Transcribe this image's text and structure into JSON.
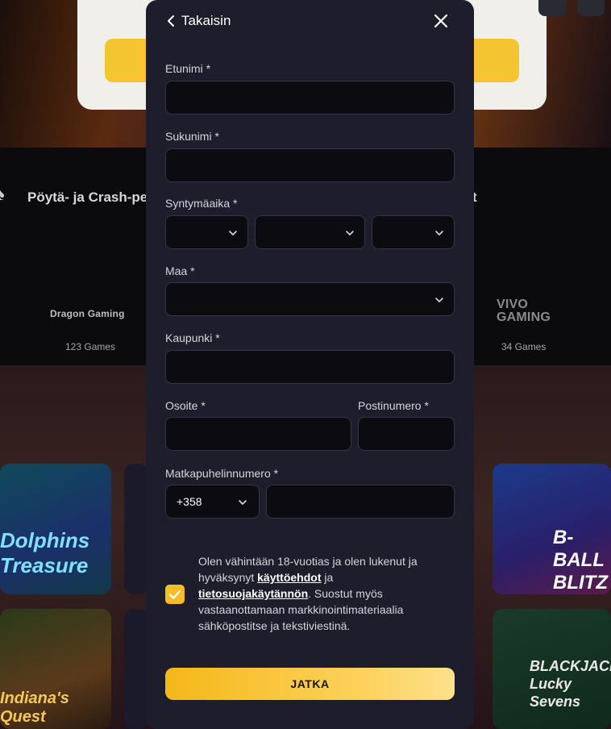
{
  "background": {
    "section_title": "Pöytä- ja Crash-pe",
    "section_title_right": "t",
    "providers": [
      {
        "name": "Dragon Gaming",
        "games": "123 Games"
      },
      {
        "name": "VIVO GAMING",
        "games": "34 Games"
      }
    ],
    "tiles": [
      "Dolphins Treasure",
      "B-BALL BLITZ",
      "Indiana's Quest",
      "BLACKJACK Lucky Sevens"
    ]
  },
  "header": {
    "back_label": "Takaisin"
  },
  "form": {
    "first_name_label": "Etunimi *",
    "last_name_label": "Sukunimi *",
    "birthdate_label": "Syntymäaika *",
    "country_label": "Maa *",
    "city_label": "Kaupunki *",
    "address_label": "Osoite *",
    "postcode_label": "Postinumero *",
    "phone_label": "Matkapuhelinnumero *",
    "phone_code": "+358",
    "values": {
      "first_name": "",
      "last_name": "",
      "day": "",
      "month": "",
      "year": "",
      "country": "",
      "city": "",
      "address": "",
      "postcode": "",
      "phone": ""
    }
  },
  "consent": {
    "checked": true,
    "text_1": "Olen vähintään 18-vuotias ja olen lukenut ja hyväksynyt ",
    "terms_link": "käyttöehdot",
    "text_2": " ja ",
    "privacy_link": "tietosuojakäytännön",
    "text_3": ". Suostut myös vastaanottamaan markkinointimateriaalia sähköpostitse ja tekstiviestinä."
  },
  "submit_label": "JATKA",
  "colors": {
    "accent": "#f7bd24",
    "modal_bg": "#1d1d2b",
    "input_bg": "#0c0c10"
  },
  "icons": {
    "back": "chevron-left-icon",
    "close": "close-icon",
    "dropdown": "chevron-down-icon",
    "check": "check-icon"
  }
}
